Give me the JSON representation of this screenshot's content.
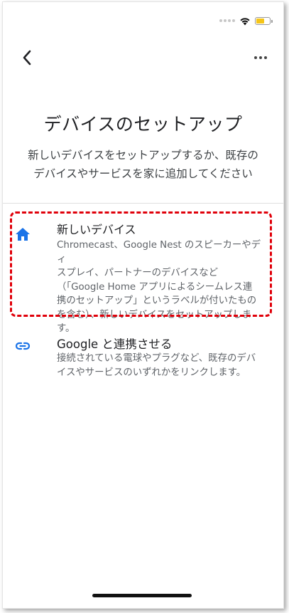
{
  "status_bar": {
    "wifi_icon": "wifi-icon",
    "battery_icon": "battery-icon",
    "battery_color": "#f5c518"
  },
  "header": {
    "back_icon": "chevron-left-icon",
    "more_icon": "more-horizontal-icon"
  },
  "page": {
    "title": "デバイスのセットアップ",
    "subtitle_line1": "新しいデバイスをセットアップするか、既存の",
    "subtitle_line2": "デバイスやサービスを家に追加してください"
  },
  "options": [
    {
      "icon": "home-icon",
      "title": "新しいデバイス",
      "desc_lines": [
        "Chromecast、Google Nest のスピーカーやディ",
        "スプレイ、パートナーのデバイスなど",
        "（「Google Home アプリによるシームレス連",
        "携のセットアップ」というラベルが付いたもの",
        "を含む）、新しいデバイスをセットアップしま",
        "す。"
      ]
    },
    {
      "icon": "link-icon",
      "title": "Google と連携させる",
      "desc_lines": [
        "接続されている電球やプラグなど、既存のデバ",
        "イスやサービスのいずれかをリンクします。"
      ]
    }
  ],
  "colors": {
    "accent": "#1a73e8",
    "highlight": "#e0000a"
  }
}
